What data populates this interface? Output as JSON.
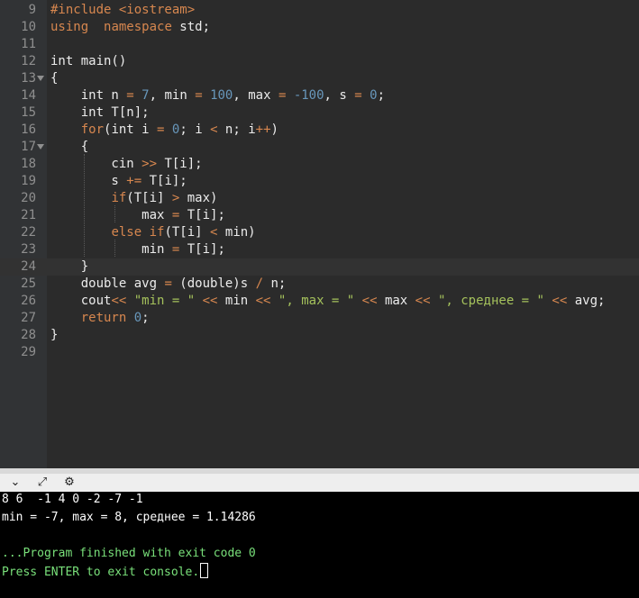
{
  "editor": {
    "lines": [
      {
        "n": "9",
        "t": [
          [
            "kw",
            "#include <iostream>"
          ]
        ]
      },
      {
        "n": "10",
        "t": [
          [
            "kw",
            "using"
          ],
          [
            "",
            "  "
          ],
          [
            "kw",
            "namespace"
          ],
          [
            "",
            " std;"
          ]
        ]
      },
      {
        "n": "11",
        "t": []
      },
      {
        "n": "12",
        "t": [
          [
            "",
            "int main()"
          ]
        ]
      },
      {
        "n": "13",
        "fold": true,
        "t": [
          [
            "",
            "{"
          ]
        ]
      },
      {
        "n": "14",
        "t": [
          [
            "",
            "    int n "
          ],
          [
            "kw",
            "="
          ],
          [
            "",
            " "
          ],
          [
            "num",
            "7"
          ],
          [
            "",
            ", min "
          ],
          [
            "kw",
            "="
          ],
          [
            "",
            " "
          ],
          [
            "num",
            "100"
          ],
          [
            "",
            ", max "
          ],
          [
            "kw",
            "="
          ],
          [
            "",
            " "
          ],
          [
            "num",
            "-100"
          ],
          [
            "",
            ", s "
          ],
          [
            "kw",
            "="
          ],
          [
            "",
            " "
          ],
          [
            "num",
            "0"
          ],
          [
            "",
            ";"
          ]
        ]
      },
      {
        "n": "15",
        "t": [
          [
            "",
            "    int T[n];"
          ]
        ]
      },
      {
        "n": "16",
        "t": [
          [
            "",
            "    "
          ],
          [
            "kw",
            "for"
          ],
          [
            "",
            "(int i "
          ],
          [
            "kw",
            "="
          ],
          [
            "",
            " "
          ],
          [
            "num",
            "0"
          ],
          [
            "",
            "; i "
          ],
          [
            "kw",
            "<"
          ],
          [
            "",
            " n; i"
          ],
          [
            "kw",
            "++"
          ],
          [
            "",
            ")"
          ]
        ]
      },
      {
        "n": "17",
        "fold": true,
        "t": [
          [
            "",
            "    {"
          ]
        ]
      },
      {
        "n": "18",
        "t": [
          [
            "",
            "        cin "
          ],
          [
            "kw",
            ">>"
          ],
          [
            "",
            " T[i];"
          ]
        ]
      },
      {
        "n": "19",
        "t": [
          [
            "",
            "        s "
          ],
          [
            "kw",
            "+="
          ],
          [
            "",
            " T[i];"
          ]
        ]
      },
      {
        "n": "20",
        "t": [
          [
            "",
            "        "
          ],
          [
            "kw",
            "if"
          ],
          [
            "",
            "(T[i] "
          ],
          [
            "kw",
            ">"
          ],
          [
            "",
            " max)"
          ]
        ]
      },
      {
        "n": "21",
        "t": [
          [
            "",
            "            max "
          ],
          [
            "kw",
            "="
          ],
          [
            "",
            " T[i];"
          ]
        ]
      },
      {
        "n": "22",
        "t": [
          [
            "",
            "        "
          ],
          [
            "kw",
            "else if"
          ],
          [
            "",
            "(T[i] "
          ],
          [
            "kw",
            "<"
          ],
          [
            "",
            " min)"
          ]
        ]
      },
      {
        "n": "23",
        "t": [
          [
            "",
            "            min "
          ],
          [
            "kw",
            "="
          ],
          [
            "",
            " T[i];"
          ]
        ]
      },
      {
        "n": "24",
        "current": true,
        "t": [
          [
            "",
            "    }"
          ]
        ]
      },
      {
        "n": "25",
        "t": [
          [
            "",
            "    double avg "
          ],
          [
            "kw",
            "="
          ],
          [
            "",
            " (double)s "
          ],
          [
            "kw",
            "/"
          ],
          [
            "",
            " n;"
          ]
        ]
      },
      {
        "n": "26",
        "t": [
          [
            "",
            "    cout"
          ],
          [
            "kw",
            "<<"
          ],
          [
            "",
            " "
          ],
          [
            "str",
            "\"min = \""
          ],
          [
            "",
            " "
          ],
          [
            "kw",
            "<<"
          ],
          [
            "",
            " min "
          ],
          [
            "kw",
            "<<"
          ],
          [
            "",
            " "
          ],
          [
            "str",
            "\", max = \""
          ],
          [
            "",
            " "
          ],
          [
            "kw",
            "<<"
          ],
          [
            "",
            " max "
          ],
          [
            "kw",
            "<<"
          ],
          [
            "",
            " "
          ],
          [
            "str",
            "\", среднее = \""
          ],
          [
            "",
            " "
          ],
          [
            "kw",
            "<<"
          ],
          [
            "",
            " avg;"
          ]
        ]
      },
      {
        "n": "27",
        "t": [
          [
            "",
            "    "
          ],
          [
            "kw",
            "return"
          ],
          [
            "",
            " "
          ],
          [
            "num",
            "0"
          ],
          [
            "",
            ";"
          ]
        ]
      },
      {
        "n": "28",
        "t": [
          [
            "",
            "}"
          ]
        ]
      },
      {
        "n": "29",
        "t": []
      }
    ]
  },
  "toolbar": {
    "collapse_icon": "chevron-down-icon",
    "expand_icon": "expand-arrows-icon",
    "settings_icon": "gear-icon"
  },
  "console": {
    "input_line": "8 6  -1 4 0 -2 -7 -1",
    "output_line": "min = -7, max = 8, среднее = 1.14286",
    "exit_line": "...Program finished with exit code 0",
    "prompt_line": "Press ENTER to exit console."
  },
  "colors": {
    "keyword": "#d7874f",
    "number": "#6897bb",
    "string": "#a5c25c",
    "console_green": "#79e07a"
  }
}
